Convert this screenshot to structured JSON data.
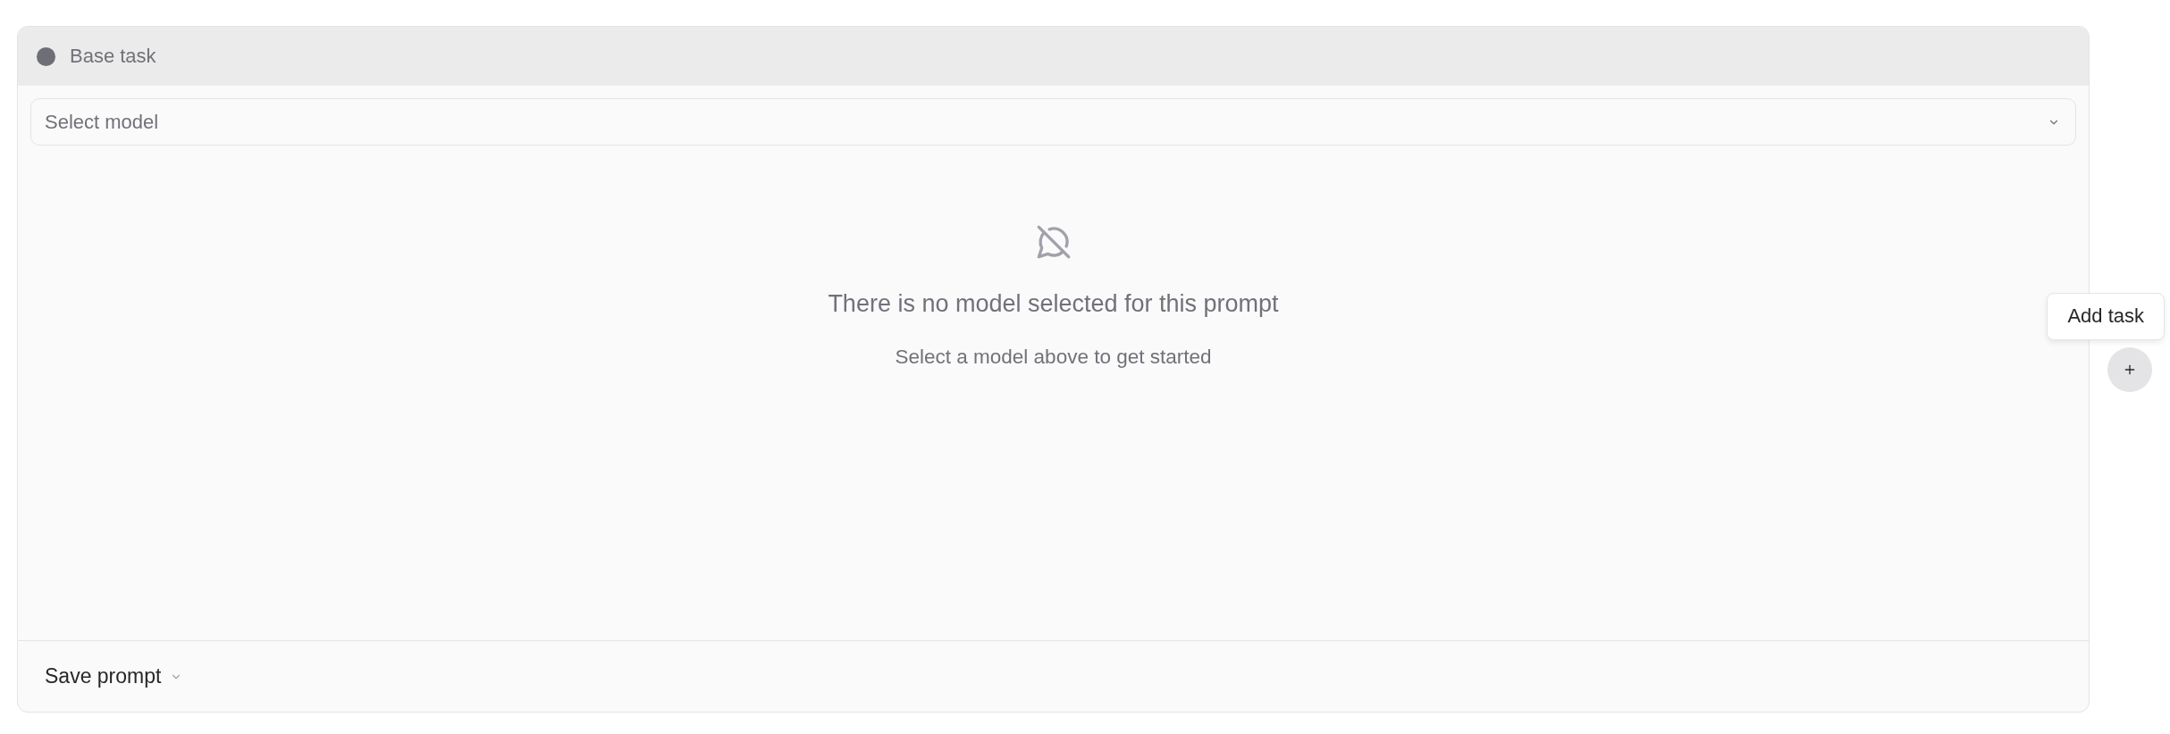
{
  "task": {
    "title": "Base task"
  },
  "model_select": {
    "placeholder": "Select model"
  },
  "empty_state": {
    "title": "There is no model selected for this prompt",
    "subtitle": "Select a model above to get started"
  },
  "footer": {
    "save_button": "Save prompt"
  },
  "add_task": {
    "tooltip": "Add task"
  }
}
